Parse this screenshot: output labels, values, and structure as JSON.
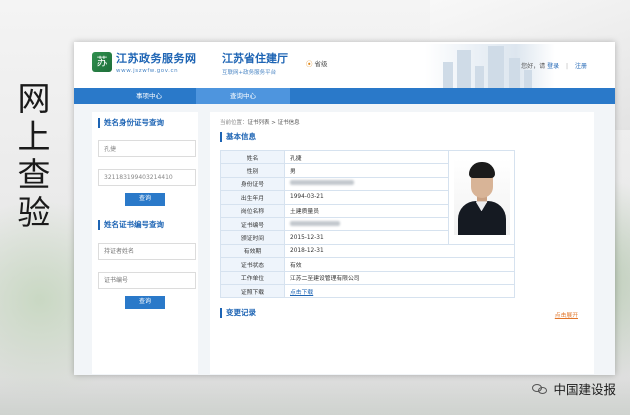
{
  "caption": [
    "网",
    "上",
    "查",
    "验"
  ],
  "header": {
    "logo_glyph": "苏",
    "brand_name": "江苏政务服务网",
    "brand_url": "www.jszwfw.gov.cn",
    "dept_name": "江苏省住建厅",
    "dept_sub": "互联网+政务服务平台",
    "location": "省级",
    "greeting": "您好，请",
    "login": "登录",
    "register": "注册"
  },
  "nav": {
    "items": [
      "事项中心",
      "查询中心"
    ],
    "active": "查询中心"
  },
  "side": {
    "section1_title": "姓名身份证号查询",
    "name_value": "孔捷",
    "id_value": "321183199403214410",
    "query_button": "查询",
    "section2_title": "姓名证书编号查询",
    "name_placeholder": "持证者姓名",
    "cert_placeholder": "证书编号",
    "query_button2": "查询"
  },
  "main": {
    "breadcrumb_prefix": "当前位置：",
    "breadcrumb_path": "证书列表 > 证书信息",
    "section_title": "基本信息",
    "fields": [
      {
        "label": "姓名",
        "value": "孔捷"
      },
      {
        "label": "性别",
        "value": "男"
      },
      {
        "label": "身份证号",
        "value": ""
      },
      {
        "label": "出生年月",
        "value": "1994-03-21"
      },
      {
        "label": "岗位名称",
        "value": "土建质量员"
      },
      {
        "label": "证书编号",
        "value": ""
      },
      {
        "label": "颁证时间",
        "value": "2015-12-31"
      },
      {
        "label": "有效期",
        "value": "2018-12-31"
      },
      {
        "label": "证书状态",
        "value": "有效"
      },
      {
        "label": "工作单位",
        "value": "江苏二至建设管理有限公司"
      },
      {
        "label": "证照下载",
        "value": "点击下载"
      }
    ],
    "records_title": "变更记录",
    "expand_label": "点击展开"
  },
  "watermark": "中国建设报",
  "colors": {
    "primary": "#2a79c9",
    "brand_blue": "#1d64b4",
    "accent_orange": "#e2762a"
  }
}
